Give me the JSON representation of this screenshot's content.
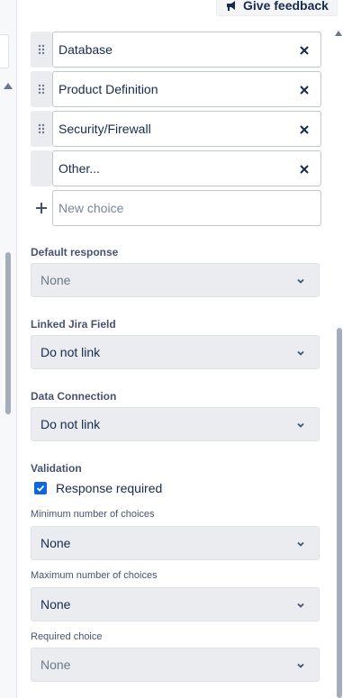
{
  "header": {
    "feedback_label": "Give feedback"
  },
  "choices": {
    "items": [
      {
        "label": "Database"
      },
      {
        "label": "Product Definition"
      },
      {
        "label": "Security/Firewall"
      },
      {
        "label": "Other..."
      }
    ],
    "new_choice_placeholder": "New choice"
  },
  "default_response": {
    "label": "Default response",
    "value": "None"
  },
  "linked_jira_field": {
    "label": "Linked Jira Field",
    "value": "Do not link"
  },
  "data_connection": {
    "label": "Data Connection",
    "value": "Do not link"
  },
  "validation": {
    "label": "Validation",
    "response_required_label": "Response required",
    "response_required_checked": true,
    "min_choices": {
      "label": "Minimum number of choices",
      "value": "None"
    },
    "max_choices": {
      "label": "Maximum number of choices",
      "value": "None"
    },
    "required_choice": {
      "label": "Required choice",
      "value": "None"
    }
  },
  "icons": {
    "feedback": "megaphone-icon",
    "drag": "drag-handle-icon",
    "remove": "close-icon",
    "add": "plus-icon",
    "dropdown": "chevron-down-icon",
    "check": "checkmark-icon"
  },
  "colors": {
    "accent": "#0c66e4",
    "text": "#172b4d",
    "field_bg": "#ebecf0",
    "border": "#c1c7d0"
  }
}
